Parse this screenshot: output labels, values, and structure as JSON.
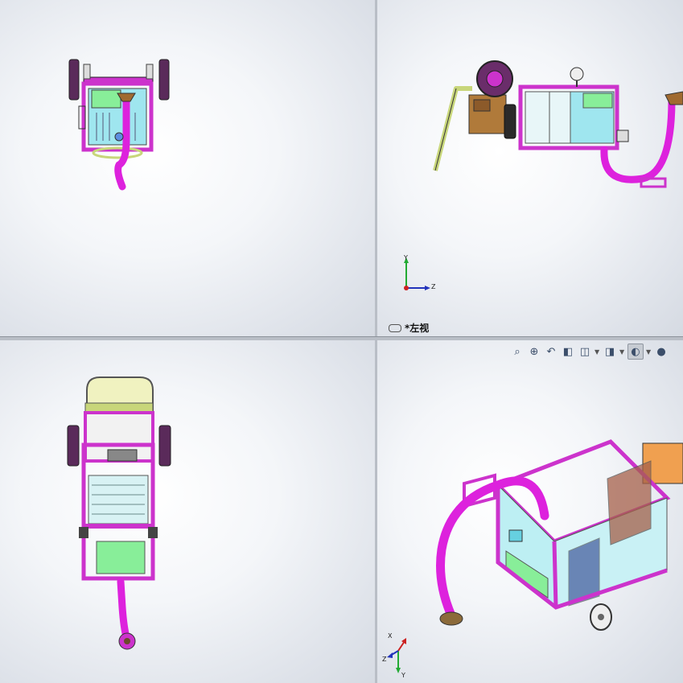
{
  "viewports": {
    "top_right": {
      "view_label": "*左视",
      "triad": {
        "y": "Y",
        "z": "Z"
      }
    },
    "bottom_right": {
      "triad": {
        "x": "X",
        "y": "Y",
        "z": "Z"
      }
    }
  },
  "toolbar": {
    "buttons": [
      {
        "icon": "zoom-to-fit-icon"
      },
      {
        "icon": "zoom-to-area-icon"
      },
      {
        "icon": "previous-view-icon"
      },
      {
        "icon": "section-view-icon"
      },
      {
        "icon": "view-orientation-icon"
      },
      {
        "icon": "display-style-icon"
      },
      {
        "icon": "hide-show-items-icon"
      },
      {
        "icon": "edit-appearance-icon"
      }
    ]
  },
  "colors": {
    "frame": "#cc33cc",
    "hose": "#dd22dd",
    "glass": "#9fe6ef",
    "green_panel": "#88ee99",
    "handle": "#c8d67a",
    "engine": "#b07a3a",
    "axis_x": "#cc2222",
    "axis_y": "#22aa33",
    "axis_z": "#2233bb"
  }
}
